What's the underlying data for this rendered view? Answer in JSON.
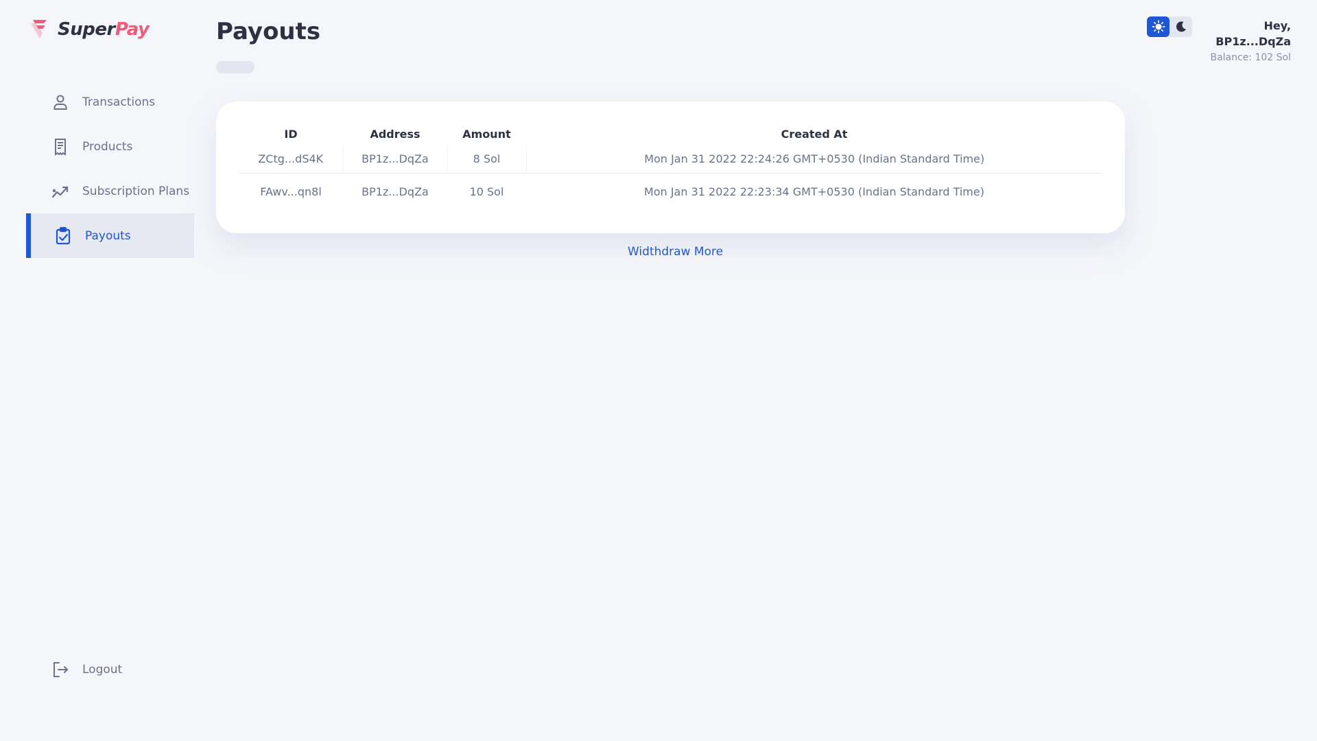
{
  "brand": {
    "name_part1": "Super",
    "name_part2": "Pay",
    "accent": "#f15a78"
  },
  "sidebar": {
    "items": [
      {
        "label": "Transactions",
        "icon": "user-icon",
        "active": false
      },
      {
        "label": "Products",
        "icon": "receipt-icon",
        "active": false
      },
      {
        "label": "Subscription Plans",
        "icon": "trend-icon",
        "active": false
      },
      {
        "label": "Payouts",
        "icon": "clipboard-check-icon",
        "active": true
      }
    ],
    "logout_label": "Logout"
  },
  "page": {
    "title": "Payouts"
  },
  "table": {
    "headers": [
      "ID",
      "Address",
      "Amount",
      "Created At"
    ],
    "rows": [
      {
        "id": "ZCtg...dS4K",
        "address": "BP1z...DqZa",
        "amount": "8 Sol",
        "created_at": "Mon Jan 31 2022 22:24:26 GMT+0530 (Indian Standard Time)"
      },
      {
        "id": "FAwv...qn8l",
        "address": "BP1z...DqZa",
        "amount": "10 Sol",
        "created_at": "Mon Jan 31 2022 22:23:34 GMT+0530 (Indian Standard Time)"
      }
    ]
  },
  "withdraw_label": "Widthdraw More",
  "theme": {
    "mode": "light",
    "light_icon": "sun-icon",
    "dark_icon": "moon-icon",
    "accent": "#1f56d1"
  },
  "user": {
    "greeting": "Hey,",
    "address": "BP1z...DqZa",
    "balance": "Balance: 102 Sol"
  }
}
